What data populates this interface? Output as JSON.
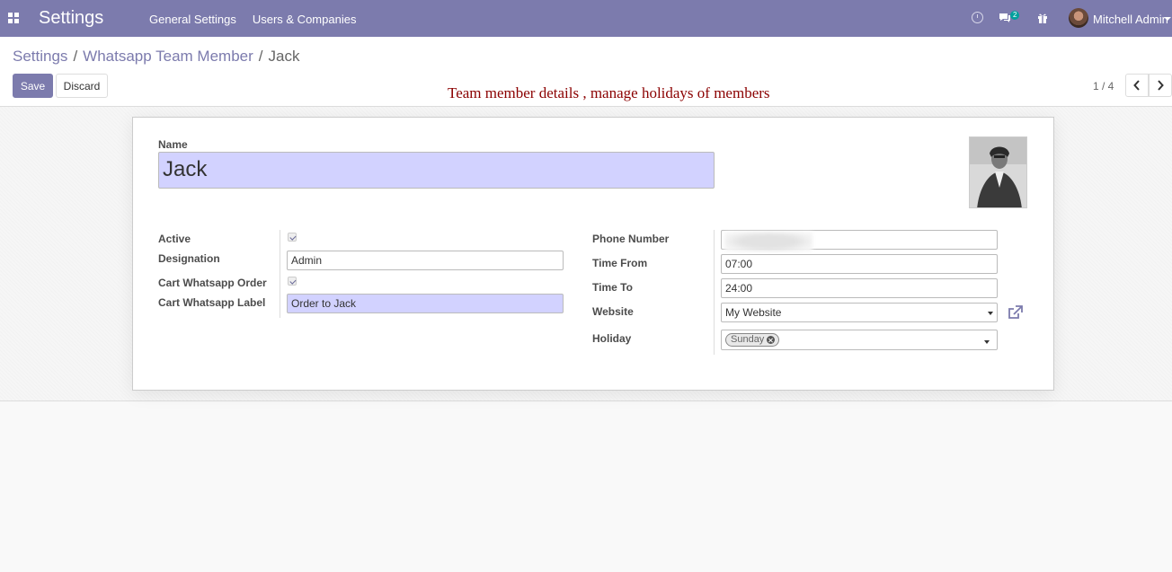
{
  "navbar": {
    "app_title": "Settings",
    "menu": [
      "General Settings",
      "Users & Companies"
    ],
    "chat_badge": "2",
    "user_name": "Mitchell Admin",
    "color": "#7c7bad"
  },
  "breadcrumb": {
    "items": [
      "Settings",
      "Whatsapp Team Member",
      "Jack"
    ],
    "separator": "/"
  },
  "actions": {
    "save_label": "Save",
    "discard_label": "Discard"
  },
  "annotation": "Team member details , manage holidays of members",
  "pager": {
    "value": "1 / 4"
  },
  "form": {
    "name_label": "Name",
    "name_value": "Jack",
    "left": {
      "active_label": "Active",
      "active_checked": true,
      "designation_label": "Designation",
      "designation_value": "Admin",
      "cart_order_label": "Cart Whatsapp Order",
      "cart_order_checked": true,
      "cart_label_label": "Cart Whatsapp Label",
      "cart_label_value": "Order to Jack"
    },
    "right": {
      "phone_label": "Phone Number",
      "time_from_label": "Time From",
      "time_from_value": "07:00",
      "time_to_label": "Time To",
      "time_to_value": "24:00",
      "website_label": "Website",
      "website_value": "My Website",
      "holiday_label": "Holiday",
      "holiday_tags": [
        "Sunday"
      ]
    }
  },
  "icons": {
    "apps": "apps-grid-icon",
    "activity": "clock-icon",
    "messaging": "chat-icon",
    "gift": "gift-icon",
    "external": "external-link-icon"
  }
}
